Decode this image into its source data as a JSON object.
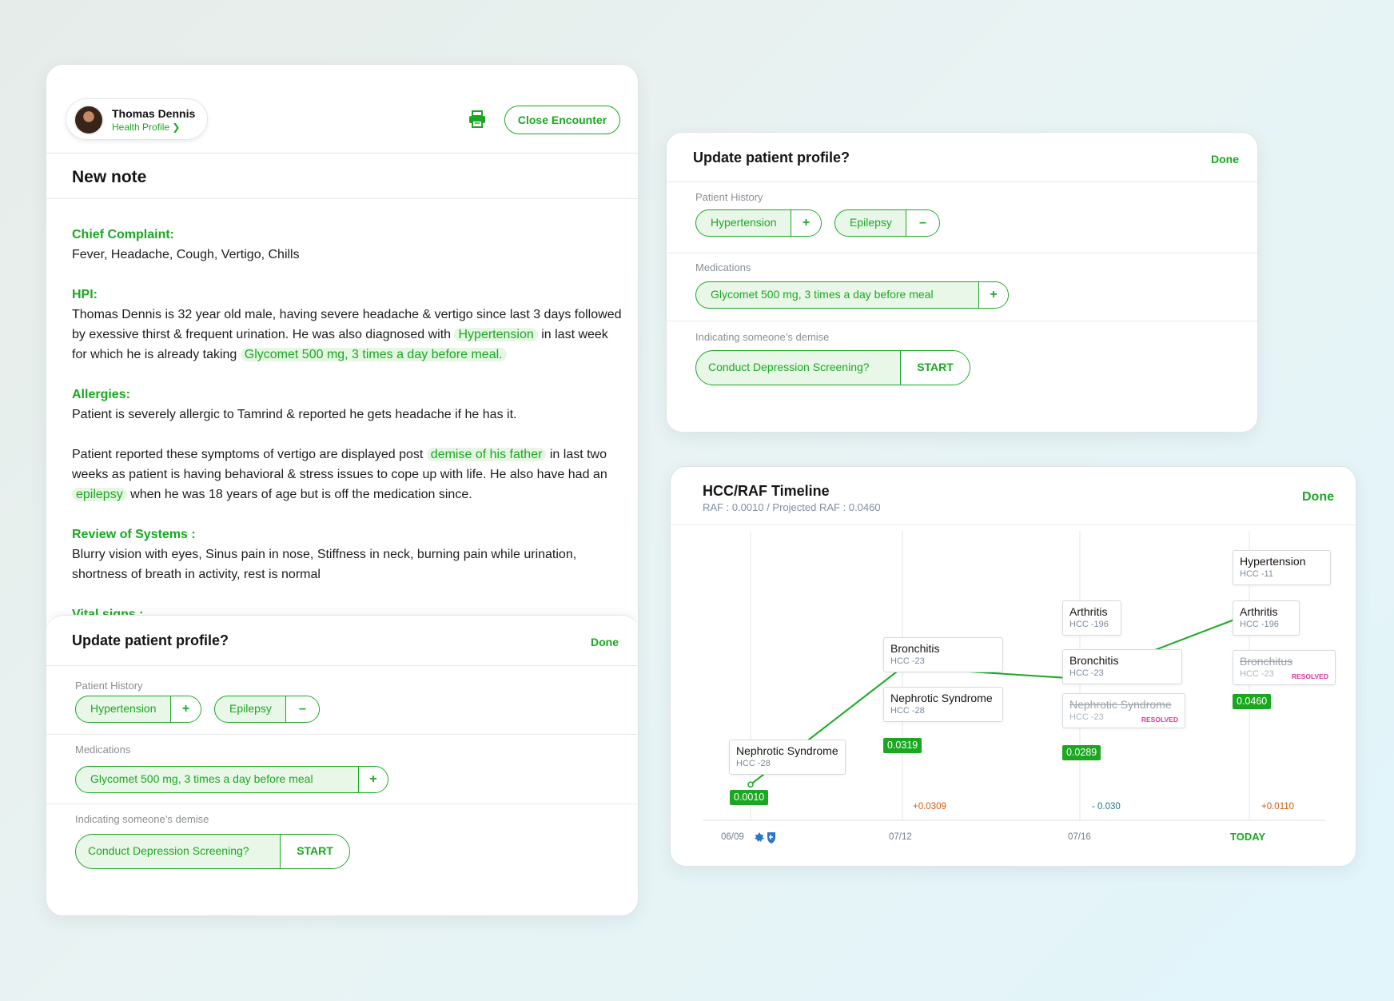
{
  "note_card": {
    "patient": {
      "name": "Thomas Dennis",
      "link": "Health Profile ❯"
    },
    "close_label": "Close Encounter",
    "title": "New note",
    "chief_complaint": {
      "heading": "Chief Complaint:",
      "text": "Fever, Headache, Cough, Vertigo, Chills"
    },
    "hpi": {
      "heading": "HPI:",
      "t1": "Thomas Dennis is 32 year old male, having severe headache & vertigo since last 3 days followed by exessive  thirst & frequent urination. He was also diagnosed with ",
      "h1": "Hypertension",
      "t2": " in last week for which he is already taking ",
      "h2": "Glycomet 500 mg, 3 times a day before meal."
    },
    "allergies": {
      "heading": "Allergies:",
      "text": "Patient is severely allergic to Tamrind & reported he gets headache if he has it."
    },
    "history_para": {
      "t1": "Patient reported these symptoms of vertigo are displayed post ",
      "h1": "demise of his father",
      "t2": " in last two weeks as patient is having behavioral & stress issues to cope up with life. He also have had an ",
      "h2": "epilepsy",
      "t3": " when he was 18 years of age but is off the medication since."
    },
    "ros": {
      "heading": "Review of Systems :",
      "text": "Blurry vision with eyes, Sinus pain in nose, Stiffness in neck, burning pain while urination, shortness of breath in activity, rest is normal"
    },
    "vitals_heading": "Vital signs :"
  },
  "profile_update": {
    "title": "Update patient profile?",
    "done": "Done",
    "history_label": "Patient History",
    "history_items": [
      {
        "label": "Hypertension",
        "action": "+"
      },
      {
        "label": "Epilepsy",
        "action": "–"
      }
    ],
    "medications_label": "Medications",
    "medication": {
      "label": "Glycomet 500 mg, 3 times a day before meal",
      "action": "+"
    },
    "demise_label": "Indicating someone’s demise",
    "screening": {
      "label": "Conduct Depression Screening?",
      "action": "START"
    }
  },
  "timeline": {
    "title": "HCC/RAF Timeline",
    "subtitle": "RAF : 0.0010 / Projected RAF : 0.0460",
    "done": "Done",
    "dates": [
      "06/09",
      "07/12",
      "07/16",
      "TODAY"
    ],
    "raf_values": [
      "0.0010",
      "0.0319",
      "0.0289",
      "0.0460"
    ],
    "deltas": [
      "+0.0309",
      "- 0.030",
      "+0.0110"
    ],
    "boxes": {
      "c0_1": {
        "name": "Nephrotic Syndrome",
        "code": "HCC -28"
      },
      "c1_1": {
        "name": "Bronchitis",
        "code": "HCC -23"
      },
      "c1_2": {
        "name": "Nephrotic Syndrome",
        "code": "HCC -28"
      },
      "c2_1": {
        "name": "Arthritis",
        "code": "HCC -196"
      },
      "c2_2": {
        "name": "Bronchitis",
        "code": "HCC -23"
      },
      "c2_3": {
        "name": "Nephrotic Syndrome",
        "code": "HCC -23",
        "badge": "RESOLVED"
      },
      "c3_1": {
        "name": "Hypertension",
        "code": "HCC -11"
      },
      "c3_2": {
        "name": "Arthritis",
        "code": "HCC -196"
      },
      "c3_3": {
        "name": "Bronchitus",
        "code": "HCC -23",
        "badge": "RESOLVED"
      }
    },
    "colors": {
      "line": "#1aa821",
      "down_point": "#d11a1a",
      "positive_delta": "#d25a10",
      "negative_delta": "#1e7a86"
    }
  }
}
